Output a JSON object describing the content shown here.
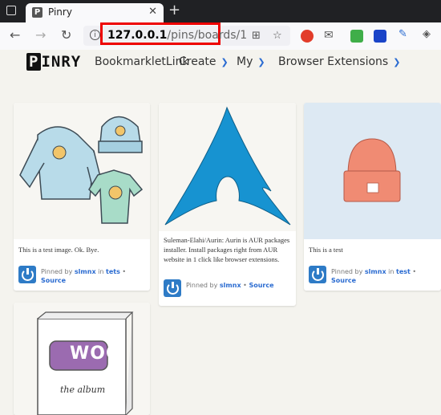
{
  "browser": {
    "tab_title": "Pinry",
    "url_host": "127.0.0.1",
    "url_path": "/pins/boards/1"
  },
  "header": {
    "logo": "PINRY",
    "menu": [
      "BookmarkletLink",
      "Create",
      "My",
      "Browser Extensions"
    ]
  },
  "pins": [
    {
      "desc": "This is a test image. Ok. Bye.",
      "pinned_by": "Pinned by",
      "user": "slmnx",
      "in": "in",
      "board": "tets",
      "source": "Source"
    },
    {
      "desc": "Suleman-Elahi/Aurin: Aurin is AUR packages installer. Install packages right from AUR website in 1 click like browser extensions.",
      "pinned_by": "Pinned by",
      "user": "slmnx",
      "source": "Source"
    },
    {
      "desc": "This is a test",
      "pinned_by": "Pinned by",
      "user": "slmnx",
      "in": "in",
      "board": "test",
      "source": "Source"
    },
    {
      "desc": "",
      "woo_text": "WOO",
      "album_text": "the album"
    }
  ],
  "colors": {
    "accent": "#2a6bd1",
    "highlight": "#e00000",
    "arch_blue": "#1793d1"
  }
}
